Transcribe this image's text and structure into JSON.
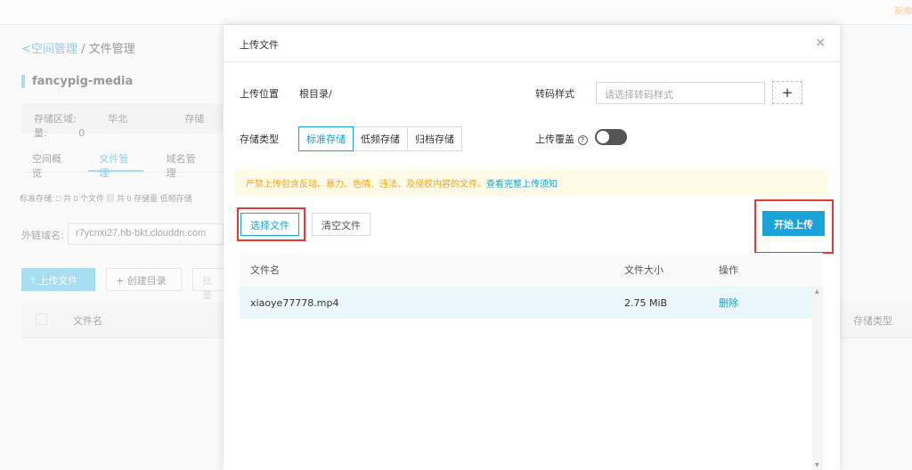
{
  "background": {
    "promo": "新推",
    "breadcrumb_back": "空间管理",
    "breadcrumb_sep": "/",
    "breadcrumb_current": "文件管理",
    "bucket_name": "fancypig-media",
    "region_label": "存储区域:",
    "region_value": "华北",
    "storage_label": "存储量:",
    "storage_value": "0",
    "tabs": [
      "空间概览",
      "文件管理",
      "域名管理"
    ],
    "stats": "标准存储: □ 共 0 个文件  ▤ 共 0 存储量  低频存储",
    "domain_label": "外链域名:",
    "domain_value": "r7ycnxi27.hb-bkt.clouddn.com",
    "upload_btn": "⤒ 上传文件",
    "mkdir_btn": "+ 创建目录",
    "batch_btn": "批量",
    "col_filename": "文件名",
    "col_storage_type": "存储类型"
  },
  "modal": {
    "title": "上传文件",
    "close": "×",
    "location_label": "上传位置",
    "location_value": "根目录/",
    "transcode_label": "转码样式",
    "transcode_placeholder": "请选择转码样式",
    "add": "+",
    "storage_type_label": "存储类型",
    "storage_types": [
      "标准存储",
      "低频存储",
      "归档存储"
    ],
    "overwrite_label": "上传覆盖",
    "help": "?",
    "overwrite_on": false,
    "warning": "严禁上传包含反动、暴力、色情、违法、及侵权内容的文件。",
    "warning_link": "查看完整上传须知",
    "select_files": "选择文件",
    "clear_files": "清空文件",
    "start_upload": "开始上传",
    "table": {
      "headers": [
        "文件名",
        "文件大小",
        "操作"
      ],
      "rows": [
        {
          "name": "xiaoye77778.mp4",
          "size": "2.75 MiB",
          "action": "删除"
        }
      ]
    }
  }
}
